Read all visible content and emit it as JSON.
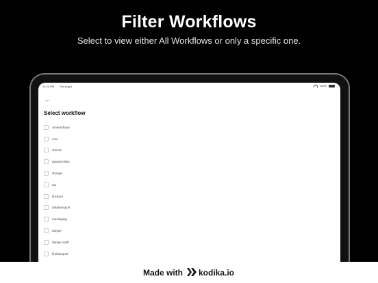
{
  "header": {
    "title": "Filter Workflows",
    "subtitle": "Select to view either All Workflows or only a specific one."
  },
  "statusbar": {
    "time": "12:23 PM",
    "date": "Thu Aug 8",
    "battery": "100%"
  },
  "screen": {
    "back_icon": "back-arrow-icon",
    "title": "Select workflow",
    "items": [
      {
        "label": "All workflows",
        "checked": false
      },
      {
        "label": "core",
        "checked": false
      },
      {
        "label": "checks",
        "checked": false
      },
      {
        "label": "dynamiclinks",
        "checked": false
      },
      {
        "label": "storage",
        "checked": false
      },
      {
        "label": "ctp",
        "checked": false
      },
      {
        "label": "firestore",
        "checked": false
      },
      {
        "label": "datatransport",
        "checked": false
      },
      {
        "label": "messaging",
        "checked": false
      },
      {
        "label": "danger",
        "checked": false
      },
      {
        "label": "danger-swift",
        "checked": false
      },
      {
        "label": "firebasepod",
        "checked": false
      }
    ]
  },
  "footer": {
    "made_with": "Made with",
    "brand": "kodika.io",
    "logo_icon": "kodika-logo-icon"
  }
}
